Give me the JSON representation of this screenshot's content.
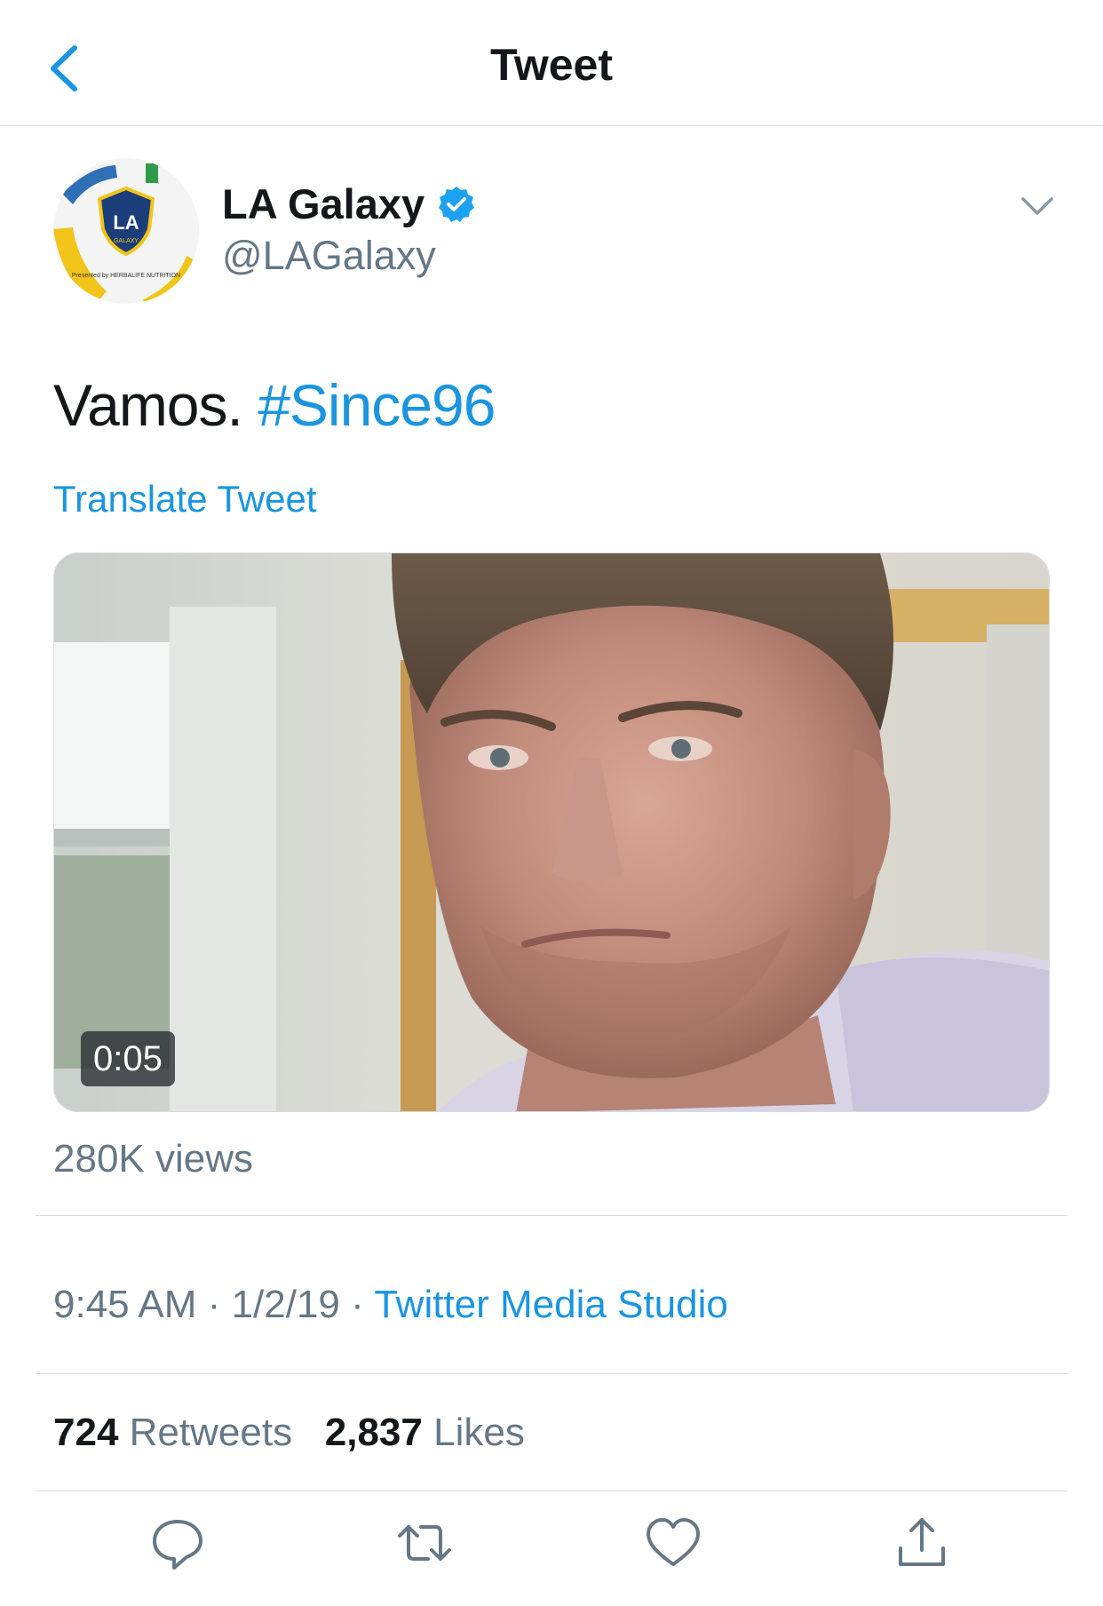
{
  "header": {
    "title": "Tweet",
    "back_icon": "chevron-left-icon"
  },
  "tweet": {
    "author": {
      "display_name": "LA Galaxy",
      "handle": "@LAGalaxy",
      "verified": true,
      "avatar_text": "LA",
      "avatar_subtext": "GALAXY",
      "avatar_sponsor": "Presented by HERBALIFE NUTRITION"
    },
    "text": "Vamos.",
    "hashtag": "#Since96",
    "translate_label": "Translate Tweet",
    "media": {
      "type": "video",
      "duration": "0:05"
    },
    "views": "280K views",
    "time": "9:45 AM",
    "separator": "·",
    "date": "1/2/19",
    "source": "Twitter Media Studio",
    "stats": {
      "retweets_count": "724",
      "retweets_label": "Retweets",
      "likes_count": "2,837",
      "likes_label": "Likes"
    }
  },
  "actions": [
    {
      "name": "reply",
      "icon": "reply-icon"
    },
    {
      "name": "retweet",
      "icon": "retweet-icon"
    },
    {
      "name": "like",
      "icon": "heart-icon"
    },
    {
      "name": "share",
      "icon": "share-icon"
    }
  ],
  "colors": {
    "accent": "#1b95e0",
    "text_primary": "#14171a",
    "text_secondary": "#657786",
    "divider": "#d7dbdf",
    "verified": "#1da1f2"
  }
}
